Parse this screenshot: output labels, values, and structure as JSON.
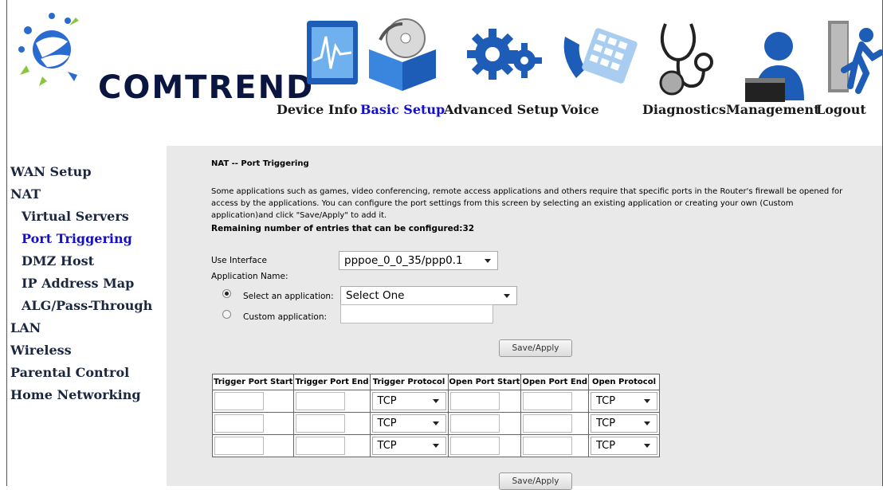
{
  "brand": {
    "logo_text": "COMTREND",
    "accent": "#1510c8",
    "logo_blue": "#2a6bd1",
    "logo_green": "#8bc53f"
  },
  "nav": {
    "items": [
      {
        "label": "Device Info",
        "icon": "monitor-graph-icon"
      },
      {
        "label": "Basic Setup",
        "icon": "cd-in-box-icon",
        "active": true
      },
      {
        "label": "Advanced Setup",
        "icon": "gears-icon"
      },
      {
        "label": "Voice",
        "icon": "phone-keypad-icon"
      },
      {
        "label": "Diagnostics",
        "icon": "stethoscope-icon"
      },
      {
        "label": "Management",
        "icon": "user-desk-icon"
      },
      {
        "label": "Logout",
        "icon": "exit-door-icon"
      }
    ]
  },
  "sidebar": {
    "items": [
      {
        "label": "WAN Setup"
      },
      {
        "label": "NAT"
      },
      {
        "label": "Virtual Servers"
      },
      {
        "label": "Port Triggering",
        "active": true
      },
      {
        "label": "DMZ Host"
      },
      {
        "label": "IP Address Map"
      },
      {
        "label": "ALG/Pass-Through"
      },
      {
        "label": "LAN"
      },
      {
        "label": "Wireless"
      },
      {
        "label": "Parental Control"
      },
      {
        "label": "Home Networking"
      }
    ]
  },
  "main": {
    "title": "NAT -- Port Triggering",
    "description": "Some applications such as games, video conferencing, remote access applications and others require that specific ports in the Router's firewall be opened for access by the applications. You can configure the port settings from this screen by selecting an existing application or creating your own (Custom application)and click \"Save/Apply\" to add it.",
    "remaining": "Remaining number of entries that can be configured:32",
    "use_interface_label": "Use Interface",
    "use_interface_value": "pppoe_0_0_35/ppp0.1",
    "application_name_label": "Application Name:",
    "select_app_label": "Select an application:",
    "select_app_value": "Select One",
    "custom_app_label": "Custom application:",
    "save_label": "Save/Apply",
    "table": {
      "headers": [
        "Trigger Port Start",
        "Trigger Port End",
        "Trigger Protocol",
        "Open Port Start",
        "Open Port End",
        "Open Protocol"
      ],
      "rows": [
        {
          "trigger_protocol": "TCP",
          "open_protocol": "TCP"
        },
        {
          "trigger_protocol": "TCP",
          "open_protocol": "TCP"
        },
        {
          "trigger_protocol": "TCP",
          "open_protocol": "TCP"
        }
      ]
    }
  }
}
